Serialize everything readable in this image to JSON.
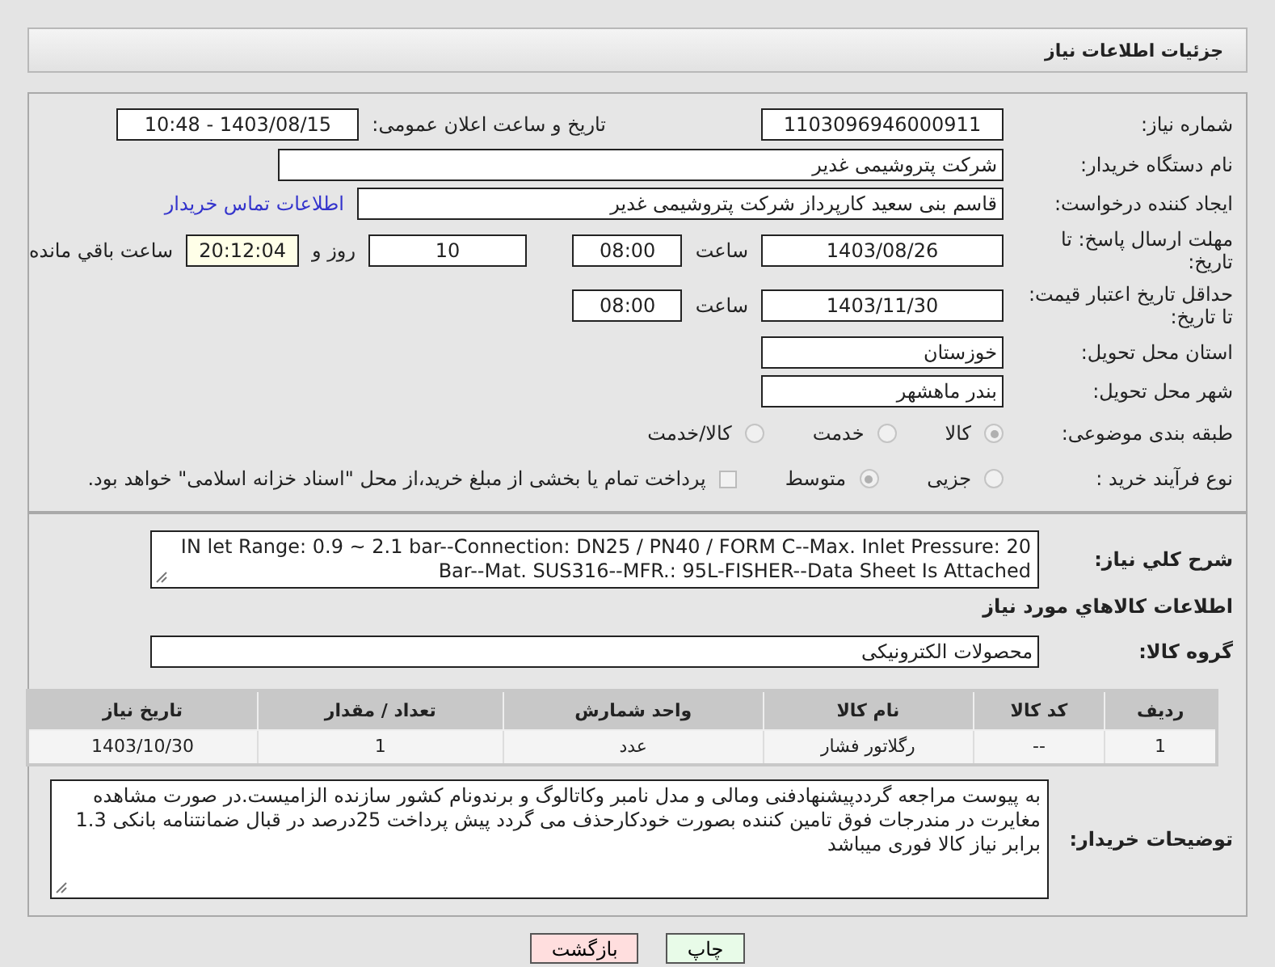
{
  "header": {
    "title": "جزئیات اطلاعات نیاز"
  },
  "need_number": {
    "label": "شماره نیاز:",
    "value": "1103096946000911"
  },
  "announce": {
    "label": "تاریخ و ساعت اعلان عمومی:",
    "value": "1403/08/15 - 10:48"
  },
  "buyer": {
    "label": "نام دستگاه خریدار:",
    "value": "شرکت پتروشیمی غدیر"
  },
  "creator": {
    "label": "ایجاد کننده درخواست:",
    "value": "قاسم بنی سعید کارپرداز شرکت پتروشیمی غدیر",
    "link": "اطلاعات تماس خریدار"
  },
  "deadline": {
    "label": "مهلت ارسال پاسخ: تا تاریخ:",
    "date": "1403/08/26",
    "time_label": "ساعت",
    "time": "08:00",
    "days": "10",
    "days_label": "روز و",
    "remaining": "20:12:04",
    "remaining_label": "ساعت باقي مانده"
  },
  "validity": {
    "label": "حداقل تاریخ اعتبار قیمت: تا تاریخ:",
    "date": "1403/11/30",
    "time_label": "ساعت",
    "time": "08:00"
  },
  "province": {
    "label": "استان محل تحویل:",
    "value": "خوزستان"
  },
  "city": {
    "label": "شهر محل تحویل:",
    "value": "بندر ماهشهر"
  },
  "category": {
    "label": "طبقه بندی موضوعی:",
    "options": [
      {
        "label": "کالا",
        "selected": true
      },
      {
        "label": "خدمت",
        "selected": false
      },
      {
        "label": "کالا/خدمت",
        "selected": false
      }
    ]
  },
  "process": {
    "label": "نوع فرآیند خرید :",
    "options": [
      {
        "label": "جزیی",
        "selected": false
      },
      {
        "label": "متوسط",
        "selected": true
      }
    ],
    "treasury": {
      "label": "پرداخت تمام یا بخشی از مبلغ خرید،از محل \"اسناد خزانه اسلامی\" خواهد بود.",
      "checked": false
    }
  },
  "description": {
    "label": "شرح کلي نياز:",
    "value": "IN let Range: 0.9 ~ 2.1 bar--Connection: DN25 / PN40 / FORM C--Max. Inlet Pressure: 20 Bar--Mat. SUS316--MFR.: 95L-FISHER--Data Sheet Is Attached"
  },
  "goods_heading": "اطلاعات کالاهاي مورد نياز",
  "goods_group": {
    "label": "گروه کالا:",
    "value": "محصولات الکترونیکی"
  },
  "table": {
    "columns": [
      "ردیف",
      "کد کالا",
      "نام کالا",
      "واحد شمارش",
      "تعداد / مقدار",
      "تاریخ نیاز"
    ],
    "rows": [
      [
        "1",
        "--",
        "رگلاتور فشار",
        "عدد",
        "1",
        "1403/10/30"
      ]
    ]
  },
  "buyer_notes": {
    "label": "توضیحات خریدار:",
    "value": "به پیوست مراجعه گرددپیشنهادفنی ومالی و مدل نامبر وکاتالوگ و برندونام کشور سازنده الزامیست.در صورت مشاهده مغایرت در مندرجات فوق تامین کننده بصورت خودکارحذف می گردد پیش پرداخت 25درصد در قبال ضمانتنامه بانکی 1.3 برابر نیاز کالا فوری میباشد"
  },
  "buttons": [
    {
      "label": "چاپ",
      "kind": "print"
    },
    {
      "label": "بازگشت",
      "kind": "back"
    }
  ]
}
